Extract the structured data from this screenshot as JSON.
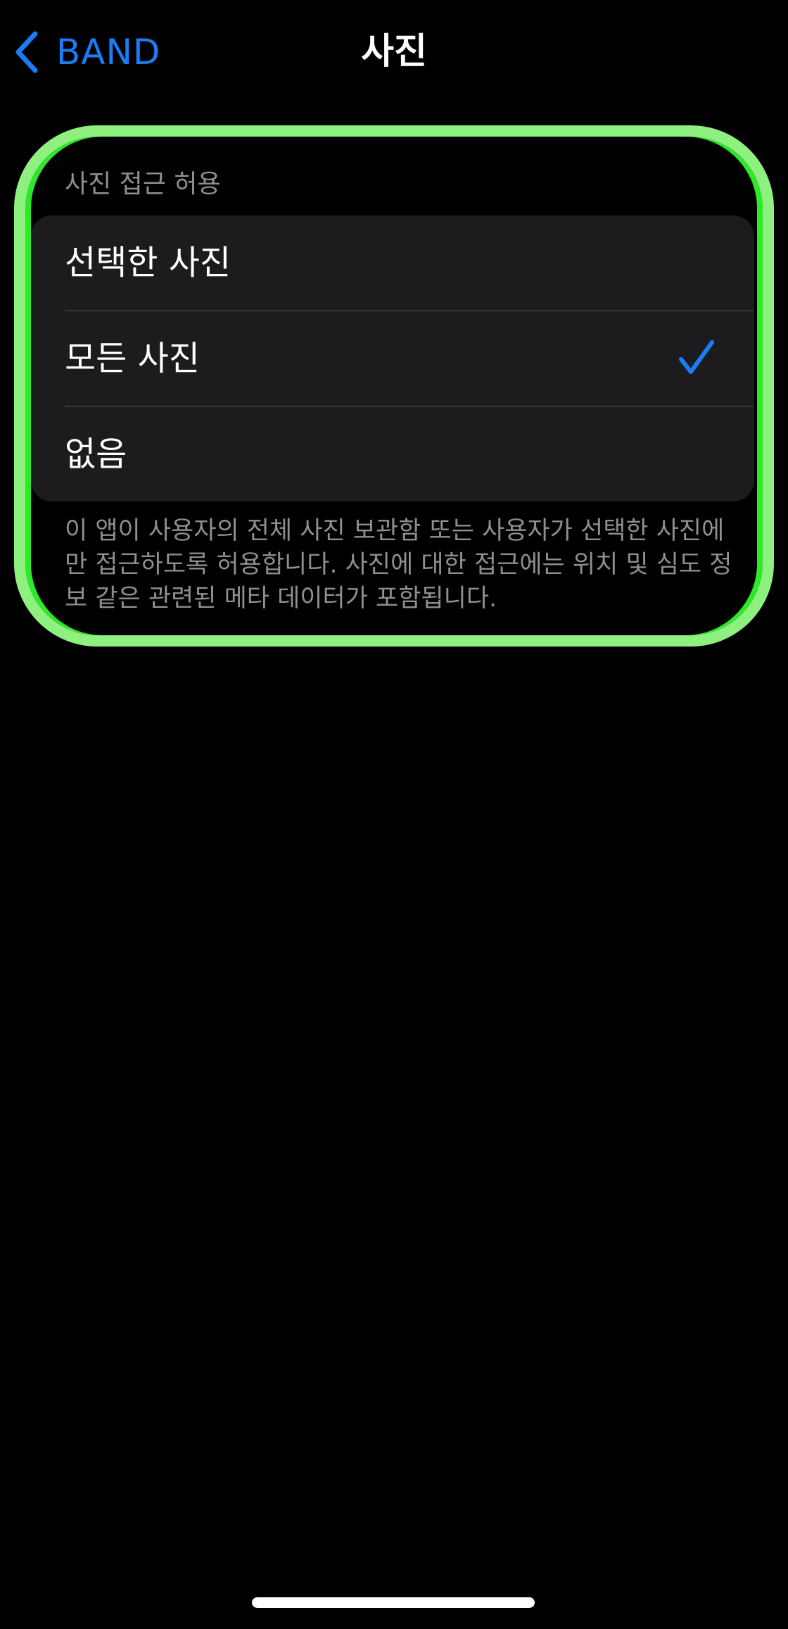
{
  "nav": {
    "back_label": "BAND",
    "title": "사진"
  },
  "section": {
    "header": "사진 접근 허용",
    "options": [
      {
        "label": "선택한 사진",
        "selected": false
      },
      {
        "label": "모든 사진",
        "selected": true
      },
      {
        "label": "없음",
        "selected": false
      }
    ],
    "footer": "이 앱이 사용자의 전체 사진 보관함 또는 사용자가 선택한 사진에만 접근하도록 허용합니다. 사진에 대한 접근에는 위치 및 심도 정보 같은 관련된 메타 데이터가 포함됩니다."
  },
  "icons": {
    "back": "chevron-left-icon",
    "selected": "checkmark-icon"
  },
  "colors": {
    "accent": "#1c7cf4",
    "background": "#000000",
    "group_background": "#1c1c1e",
    "secondary_text": "#8e8e93",
    "highlight_frame": "#8ef07f"
  }
}
